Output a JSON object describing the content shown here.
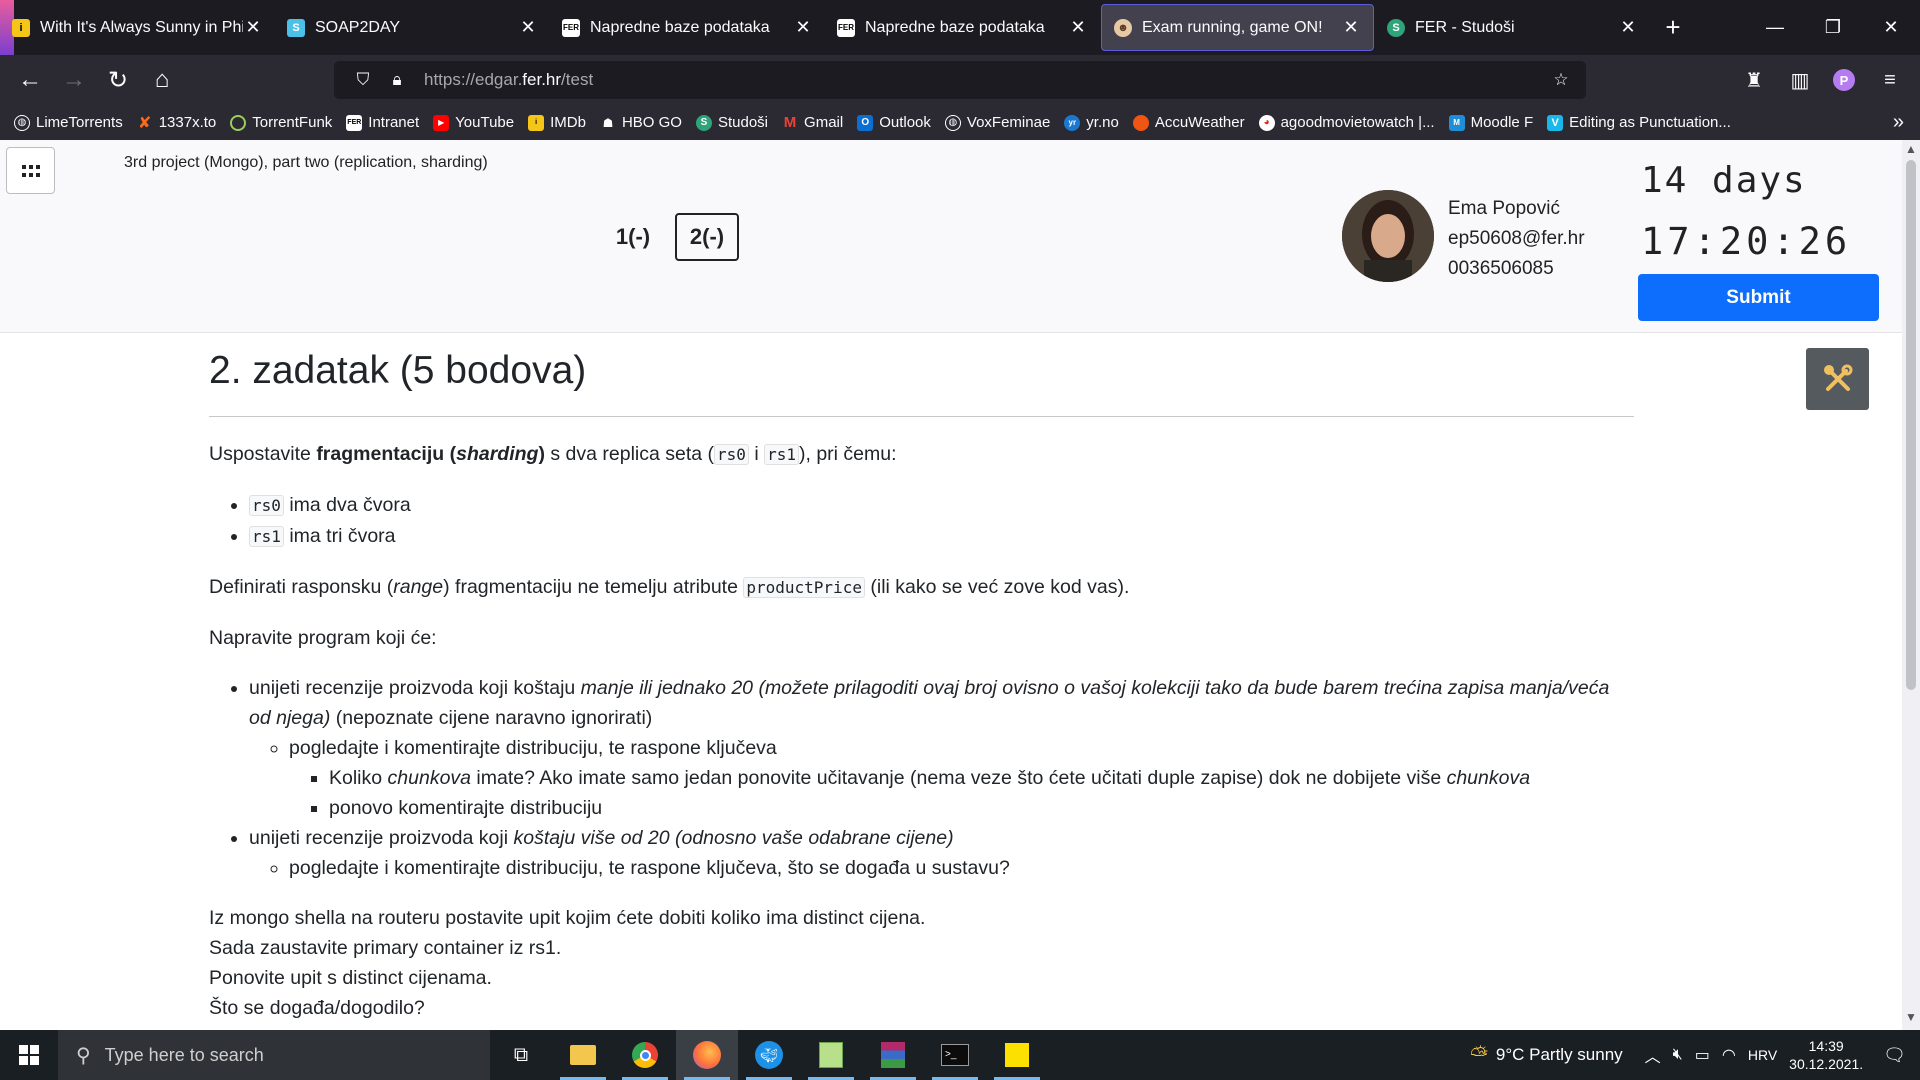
{
  "browser": {
    "tabs": [
      {
        "title": "With It's Always Sunny in Philadelphia",
        "icon": "imdb-icon",
        "active": false
      },
      {
        "title": "SOAP2DAY",
        "icon": "soap2day-icon",
        "active": false
      },
      {
        "title": "Napredne baze podataka",
        "icon": "fer-icon",
        "active": false
      },
      {
        "title": "Napredne baze podataka",
        "icon": "fer-icon",
        "active": false
      },
      {
        "title": "Exam running, game ON!",
        "icon": "edgar-icon",
        "active": true
      },
      {
        "title": "FER - Studoši",
        "icon": "studosi-icon",
        "active": false
      }
    ],
    "url_prefix": "https://edgar.",
    "url_domain": "fer.hr",
    "url_path": "/test",
    "bookmarks": [
      "LimeTorrents",
      "1337x.to",
      "TorrentFunk",
      "Intranet",
      "YouTube",
      "IMDb",
      "HBO GO",
      "Studoši",
      "Gmail",
      "Outlook",
      "VoxFeminae",
      "yr.no",
      "AccuWeather",
      "agoodmovietowatch |...",
      "Moodle F",
      "Editing as Punctuation..."
    ]
  },
  "exam": {
    "title": "3rd project (Mongo), part two (replication, sharding)",
    "questions": [
      "1(-)",
      "2(-)"
    ],
    "user": {
      "name": "Ema Popović",
      "email": "ep50608@fer.hr",
      "id": "0036506085"
    },
    "timer_days": "14 days",
    "timer_clock": "17:20:26",
    "submit_label": "Submit"
  },
  "task": {
    "heading": "2. zadatak (5 bodova)",
    "p1_a": "Uspostavite ",
    "p1_b": "fragmentaciju (",
    "p1_c": "sharding",
    "p1_d": ")",
    "p1_e": " s dva replica seta (",
    "rs0": "rs0",
    "p1_f": " i ",
    "rs1": "rs1",
    "p1_g": "), pri čemu:",
    "li_rs0": " ima dva čvora",
    "li_rs1": " ima tri čvora",
    "p2_a": "Definirati rasponsku (",
    "p2_b": "range",
    "p2_c": ") fragmentaciju ne temelju atributе ",
    "p2_code": "productPrice",
    "p2_d": " (ili kako se već zove kod vas).",
    "p3": "Napravite program koji će:",
    "b1_a": "unijeti recenzije proizvoda koji koštaju ",
    "b1_b": "manje ili jednako 20 (možete prilagoditi ovaj broj ovisno o vašoj kolekciji tako da bude barem trećina zapisa manja/veća od njega)",
    "b1_c": " (nepoznate cijene naravno ignorirati)",
    "b1_sub": "pogledajte i komentirajte distribuciju, te raspone ključeva",
    "b1_sub1_a": "Koliko ",
    "b1_sub1_b": "chunkova",
    "b1_sub1_c": " imate? Ako imate samo jedan ponovite učitavanje (nema veze što ćete učitati duple zapise) dok ne dobijete više ",
    "b1_sub1_d": "chunkova",
    "b1_sub2": "ponovo komentirajte distribuciju",
    "b2_a": "unijeti recenzije proizvoda koji ",
    "b2_b": "koštaju više od 20 (odnosno vaše odabrane cijene)",
    "b2_sub": "pogledajte i komentirajte distribuciju, te raspone ključeva, što se događa u sustavu?",
    "l1": "Iz mongo shella na routeru postavite upit kojim ćete dobiti koliko ima distinct cijena.",
    "l2": "Sada zaustavite primary container iz rs1.",
    "l3": "Ponovite upit s distinct cijenama.",
    "l4": "Što se događa/dogodilo?"
  },
  "taskbar": {
    "search_placeholder": "Type here to search",
    "weather": "9°C  Partly sunny",
    "lang": "HRV",
    "time": "14:39",
    "date": "30.12.2021."
  }
}
